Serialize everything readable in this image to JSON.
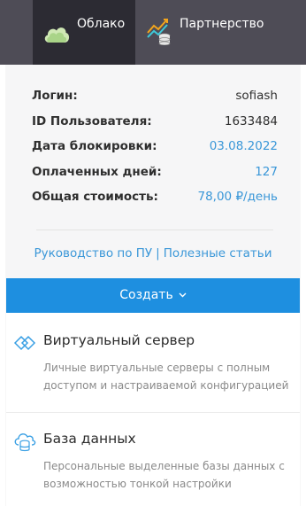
{
  "nav": {
    "tabs": [
      {
        "label": "Облако",
        "icon": "cloud-icon",
        "active": true
      },
      {
        "label": "Партнерство",
        "icon": "partnership-chart-icon",
        "active": false
      }
    ]
  },
  "account": {
    "rows": [
      {
        "key": "Логин:",
        "value": "sofiash"
      },
      {
        "key": "ID Пользователя:",
        "value": "1633484"
      },
      {
        "key": "Дата блокировки:",
        "value": "03.08.2022"
      },
      {
        "key": "Оплаченных дней:",
        "value": "127"
      },
      {
        "key": "Общая стоимость:",
        "value": "78,00 ₽/день"
      }
    ]
  },
  "links": {
    "manual": "Руководство по ПУ",
    "separator": "|",
    "articles": "Полезные статьи"
  },
  "create": {
    "label": "Создать",
    "chevron": "chevron-down-icon"
  },
  "menu": {
    "items": [
      {
        "title": "Виртуальный сервер",
        "description": "Личные виртуальные серверы с полным доступом и настраиваемой конфигурацией",
        "icon": "virtual-server-icon"
      },
      {
        "title": "База данных",
        "description": "Персональные выделенные базы данных с возможностью тонкой настройки",
        "icon": "database-cloud-icon"
      }
    ]
  },
  "colors": {
    "topbar": "#4e4c56",
    "active_tab": "#2c2b33",
    "accent": "#1e8fe0",
    "link": "#3a97d8",
    "panel": "#f6f6f7"
  }
}
